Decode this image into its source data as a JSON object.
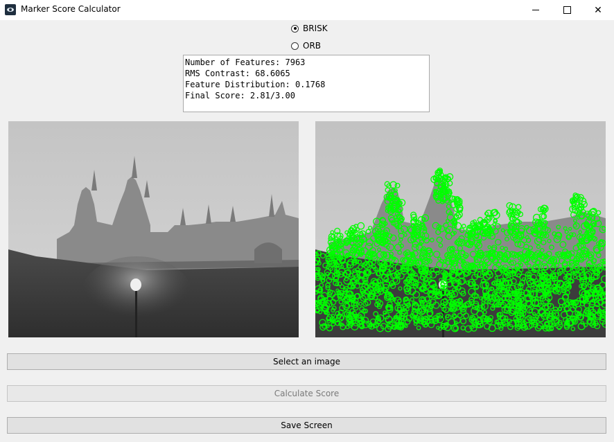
{
  "window": {
    "title": "Marker Score Calculator",
    "controls": [
      "minimize",
      "maximize",
      "close"
    ]
  },
  "options": {
    "brisk_label": "BRISK",
    "orb_label": "ORB",
    "selected": "BRISK"
  },
  "results": {
    "features": "Number of Features: 7963",
    "contrast": "RMS Contrast: 68.6065",
    "distribution": "Feature Distribution: 0.1768",
    "final": "Final Score: 2.81/3.00"
  },
  "images": {
    "left": "original-grayscale-photo",
    "right": "keypoints-overlay-photo",
    "keypoint_color": "#00ff00"
  },
  "buttons": {
    "select": "Select an image",
    "calculate": "Calculate Score",
    "save": "Save Screen"
  }
}
